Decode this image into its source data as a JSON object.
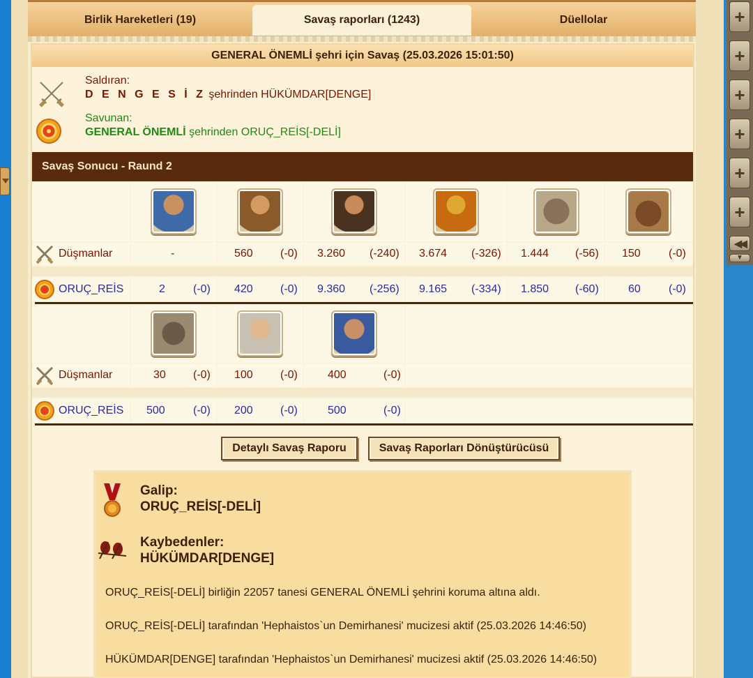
{
  "tabs": [
    {
      "label": "Birlik Hareketleri (19)"
    },
    {
      "label": "Savaş raporları (1243)"
    },
    {
      "label": "Düellolar"
    }
  ],
  "report": {
    "title": "GENERAL ÖNEMLİ şehri için Savaş (25.03.2026 15:01:50)",
    "attacker": {
      "role": "Saldıran:",
      "city": "D E N G E S İ Z",
      "city_suffix": "şehrinden",
      "player": "HÜKÜMDAR[DENGE]"
    },
    "defender": {
      "role": "Savunan:",
      "city": "GENERAL ÖNEMLİ",
      "city_suffix": "şehrinden",
      "player": "ORUÇ_REİS[-DELİ]"
    },
    "result_title": "Savaş Sonucu - Raund 2",
    "enemy_label": "Düşmanlar",
    "own_label": "ORUÇ_REİS",
    "row1": {
      "enemy": [
        {
          "count": "-",
          "loss": ""
        },
        {
          "count": "560",
          "loss": "(-0)"
        },
        {
          "count": "3.260",
          "loss": "(-240)"
        },
        {
          "count": "3.674",
          "loss": "(-326)"
        },
        {
          "count": "1.444",
          "loss": "(-56)"
        },
        {
          "count": "150",
          "loss": "(-0)"
        }
      ],
      "own": [
        {
          "count": "2",
          "loss": "(-0)"
        },
        {
          "count": "420",
          "loss": "(-0)"
        },
        {
          "count": "9.360",
          "loss": "(-256)"
        },
        {
          "count": "9.165",
          "loss": "(-334)"
        },
        {
          "count": "1.850",
          "loss": "(-60)"
        },
        {
          "count": "60",
          "loss": "(-0)"
        }
      ]
    },
    "row2": {
      "enemy": [
        {
          "count": "30",
          "loss": "(-0)"
        },
        {
          "count": "100",
          "loss": "(-0)"
        },
        {
          "count": "400",
          "loss": "(-0)"
        }
      ],
      "own": [
        {
          "count": "500",
          "loss": "(-0)"
        },
        {
          "count": "200",
          "loss": "(-0)"
        },
        {
          "count": "500",
          "loss": "(-0)"
        }
      ]
    },
    "buttons": {
      "detail": "Detaylı Savaş Raporu",
      "converter": "Savaş Raporları Dönüştürücüsü"
    },
    "summary": {
      "winner_label": "Galip:",
      "winner": "ORUÇ_REİS[-DELİ]",
      "loser_label": "Kaybedenler:",
      "loser": "HÜKÜMDAR[DENGE]",
      "lines": [
        "ORUÇ_REİS[-DELİ] birliğin 22057 tanesi GENERAL ÖNEMLİ şehrini koruma altına aldı.",
        "ORUÇ_REİS[-DELİ] tarafından 'Hephaistos`un Demirhanesi' mucizesi aktif (25.03.2026 14:46:50)",
        "HÜKÜMDAR[DENGE] tarafından 'Hephaistos`un Demirhanesi' mucizesi aktif (25.03.2026 14:46:50)"
      ]
    }
  },
  "icons": {
    "attacker": "crossed-swords-icon",
    "defender": "shield-icon",
    "winner": "medal-icon",
    "loser": "fallen-soldiers-icon",
    "side_buttons": "plus-icon"
  }
}
